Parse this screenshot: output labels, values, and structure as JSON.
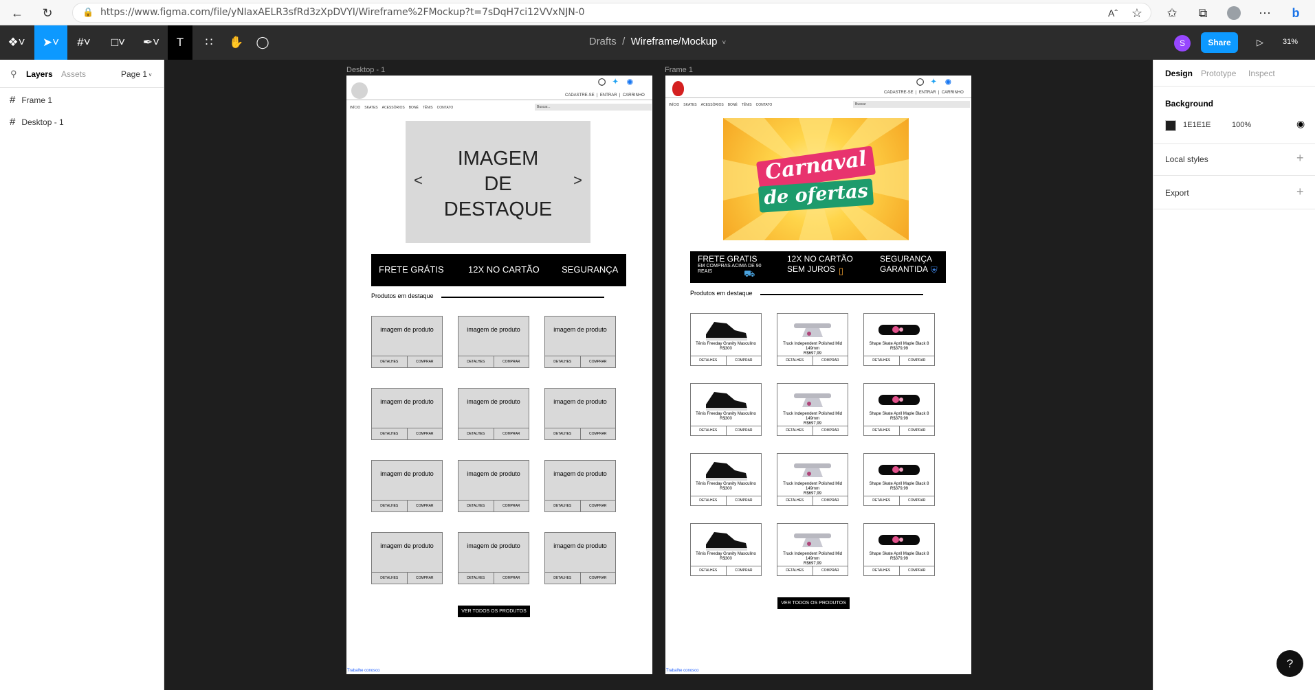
{
  "browser": {
    "url": "https://www.figma.com/file/yNIaxAELR3sfRd3zXpDVYI/Wireframe%2FMockup?t=7sDqH7ci12VVxNJN-0"
  },
  "toolbar": {
    "breadcrumb_drafts": "Drafts",
    "breadcrumb_sep": "/",
    "file_name": "Wireframe/Mockup",
    "avatar_letter": "S",
    "share_label": "Share",
    "zoom": "31%"
  },
  "left_panel": {
    "tabs": [
      "Layers",
      "Assets"
    ],
    "page": "Page 1",
    "layers": [
      "Frame 1",
      "Desktop - 1"
    ]
  },
  "right_panel": {
    "tabs": [
      "Design",
      "Prototype",
      "Inspect"
    ],
    "background_label": "Background",
    "bg_hex": "1E1E1E",
    "bg_opacity": "100%",
    "local_styles": "Local styles",
    "export": "Export"
  },
  "wireframe": {
    "frame_label": "Desktop - 1",
    "header_links": [
      "CADASTRE-SE",
      "ENTRAR",
      "CARRINHO"
    ],
    "nav": [
      "INÍCIO",
      "SKATES",
      "ACESSÓRIOS",
      "BONÉ",
      "TÊNIS",
      "CONTATO"
    ],
    "search_placeholder": "Buscar...",
    "hero_line1": "IMAGEM",
    "hero_line2": "DE",
    "hero_line3": "DESTAQUE",
    "benefits": [
      "FRETE GRÁTIS",
      "12X NO CARTÃO",
      "SEGURANÇA"
    ],
    "section_title": "Produtos em destaque",
    "card_placeholder": "imagem de produto",
    "card_btn_details": "DETALHES",
    "card_btn_buy": "COMPRAR",
    "view_all": "VER TODOS OS PRODUTOS",
    "footer": "Trabalhe conosco"
  },
  "mockup": {
    "frame_label": "Frame 1",
    "header_links": [
      "CADASTRE-SE",
      "ENTRAR",
      "CARRINHO"
    ],
    "nav": [
      "INÍCIO",
      "SKATES",
      "ACESSÓRIOS",
      "BONÉ",
      "TÊNIS",
      "CONTATO"
    ],
    "search_placeholder": "Buscar",
    "banner_line1": "Carnaval",
    "banner_line2": "de ofertas",
    "benefit1_title": "FRETE GRATIS",
    "benefit1_sub": "EM COMPRAS ACIMA DE 90 REAIS",
    "benefit2_l1": "12X NO CARTÃO",
    "benefit2_l2": "SEM JUROS",
    "benefit3_l1": "SEGURANÇA",
    "benefit3_l2": "GARANTIDA",
    "section_title": "Produtos em destaque",
    "products": [
      {
        "name": "Tênis Freeday Gravity Masculino",
        "price": "R$300"
      },
      {
        "name": "Truck Independent Polished Mid 149mm",
        "price": "R$697,99"
      },
      {
        "name": "Shape Skate April Maple Black 8",
        "price": "R$379,99"
      }
    ],
    "card_btn_details": "DETALHES",
    "card_btn_buy": "COMPRAR",
    "view_all": "VER TODOS OS PRODUTOS",
    "footer": "Trabalhe conosco"
  }
}
